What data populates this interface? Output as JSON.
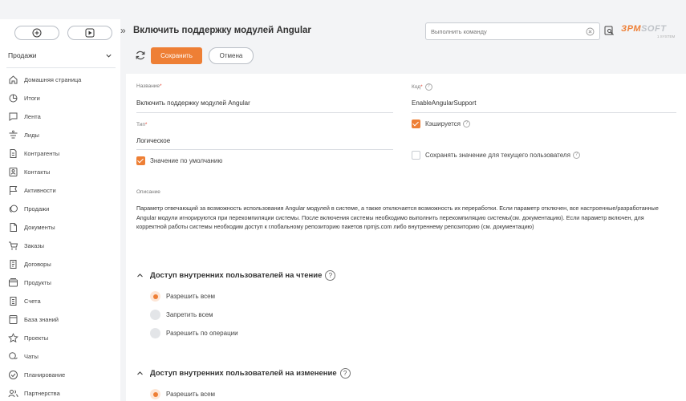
{
  "sidebar": {
    "workspace": "Продажи",
    "items": [
      {
        "label": "Домашняя страница",
        "icon": "home-icon"
      },
      {
        "label": "Итоги",
        "icon": "pie-chart-icon"
      },
      {
        "label": "Лента",
        "icon": "chat-bubble-icon"
      },
      {
        "label": "Лиды",
        "icon": "funnel-icon"
      },
      {
        "label": "Контрагенты",
        "icon": "building-icon"
      },
      {
        "label": "Контакты",
        "icon": "contact-card-icon"
      },
      {
        "label": "Активности",
        "icon": "flag-icon"
      },
      {
        "label": "Продажи",
        "icon": "coins-icon"
      },
      {
        "label": "Документы",
        "icon": "document-icon"
      },
      {
        "label": "Заказы",
        "icon": "cart-icon"
      },
      {
        "label": "Договоры",
        "icon": "contract-icon"
      },
      {
        "label": "Продукты",
        "icon": "box-icon"
      },
      {
        "label": "Счета",
        "icon": "invoice-icon"
      },
      {
        "label": "База знаний",
        "icon": "book-icon"
      },
      {
        "label": "Проекты",
        "icon": "star-icon"
      },
      {
        "label": "Чаты",
        "icon": "chats-icon"
      },
      {
        "label": "Планирование",
        "icon": "check-circle-icon"
      },
      {
        "label": "Партнерства",
        "icon": "partners-icon"
      }
    ]
  },
  "header": {
    "title": "Включить поддержку модулей Angular",
    "command_placeholder": "Выполнить команду",
    "logo_orange": "ЗРМ",
    "logo_gray": "SOFT",
    "logo_sub": "1 SYSTEM"
  },
  "actions": {
    "save": "Сохранить",
    "cancel": "Отмена"
  },
  "form": {
    "name_label": "Название",
    "name_value": "Включить поддержку модулей Angular",
    "code_label": "Код",
    "code_value": "EnableAngularSupport",
    "type_label": "Тип",
    "type_value": "Логическое",
    "cached_label": "Кэшируется",
    "cached": true,
    "default_label": "Значение по умолчанию",
    "default_value": true,
    "save_for_user_label": "Сохранять значение для текущего пользователя",
    "save_for_user": false,
    "description_label": "Описание",
    "description": "Параметр отвечающий за возможность использования Angular модулей в системе, а также отключается возможность их переработки. Если параметр отключен, все настроенные/разработанные Angular модули игнорируются при перекомпиляции системы. После включения системы необходимо выполнить перекомпиляцию системы(см. документацию). Если параметр включен, для корректной работы системы необходим доступ к глобальному репозиторию пакетов npmjs.com либо внутреннему репозиторию (см. документацию)"
  },
  "read_access": {
    "title": "Доступ внутренних пользователей на чтение",
    "options": [
      {
        "label": "Разрешить всем",
        "selected": true
      },
      {
        "label": "Запретить всем",
        "selected": false
      },
      {
        "label": "Разрешить по операции",
        "selected": false
      }
    ]
  },
  "edit_access": {
    "title": "Доступ внутренних пользователей на изменение",
    "options": [
      {
        "label": "Разрешить всем",
        "selected": true
      }
    ]
  },
  "colors": {
    "accent": "#ee7f35",
    "sidebar_bg": "#ffffff",
    "page_bg": "#f3f4f6"
  }
}
